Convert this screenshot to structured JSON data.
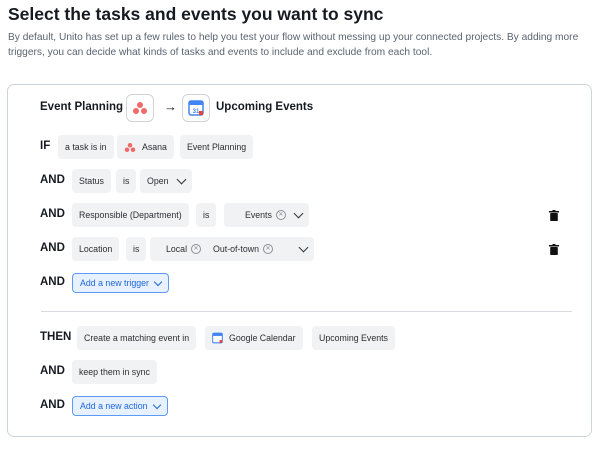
{
  "page": {
    "title": "Select the tasks and events you want to sync",
    "intro": "By default, Unito has set up a few rules to help you test your flow without messing up your connected projects. By adding more triggers, you can decide what kinds of tasks and events to include and exclude from each tool."
  },
  "header": {
    "source_name": "Event Planning",
    "source_icon": "asana-icon",
    "arrow": "→",
    "target_icon": "google-calendar-icon",
    "target_name": "Upcoming Events"
  },
  "rules": {
    "if_kw": "IF",
    "if_text": "a task is in",
    "if_tool": "Asana",
    "if_project": "Event Planning",
    "and1_kw": "AND",
    "and1_field": "Status",
    "and1_op": "is",
    "and1_value": "Open",
    "and2_kw": "AND",
    "and2_field": "Responsible (Department)",
    "and2_op": "is",
    "and2_value": "Events",
    "and3_kw": "AND",
    "and3_field": "Location",
    "and3_op": "is",
    "and3_value1": "Local",
    "and3_value2": "Out-of-town",
    "and4_kw": "AND",
    "add_trigger": "Add a new trigger"
  },
  "actions": {
    "then_kw": "THEN",
    "then_text": "Create a matching event in",
    "then_tool": "Google Calendar",
    "then_calendar": "Upcoming Events",
    "and1_kw": "AND",
    "and1_text": "keep them in sync",
    "and2_kw": "AND",
    "add_action": "Add a new action"
  },
  "colors": {
    "accent": "#1f66d8",
    "asana": "#f06a6a",
    "chip_bg": "#f1f2f4"
  }
}
